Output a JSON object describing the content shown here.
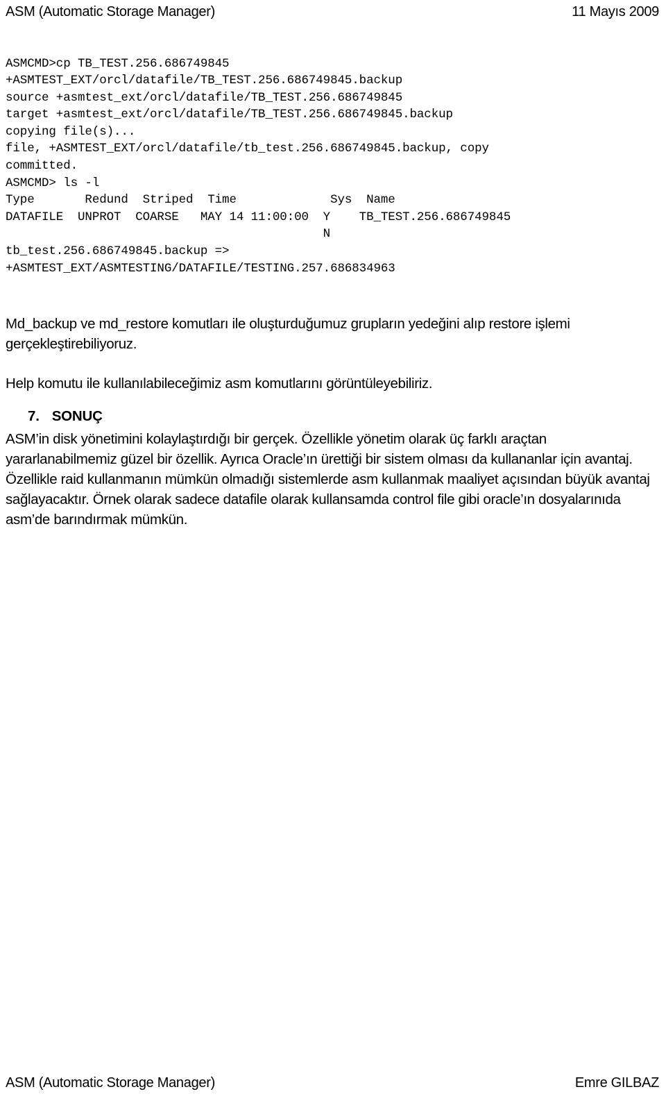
{
  "header": {
    "title": "ASM (Automatic Storage Manager)",
    "date": "11 Mayıs 2009"
  },
  "code_block": {
    "lines": [
      "ASMCMD>cp TB_TEST.256.686749845",
      "+ASMTEST_EXT/orcl/datafile/TB_TEST.256.686749845.backup",
      "source +asmtest_ext/orcl/datafile/TB_TEST.256.686749845",
      "target +asmtest_ext/orcl/datafile/TB_TEST.256.686749845.backup",
      "copying file(s)...",
      "file, +ASMTEST_EXT/orcl/datafile/tb_test.256.686749845.backup, copy",
      "committed.",
      "ASMCMD> ls -l",
      "Type       Redund  Striped  Time             Sys  Name",
      "DATAFILE  UNPROT  COARSE   MAY 14 11:00:00  Y    TB_TEST.256.686749845",
      "                                            N",
      "tb_test.256.686749845.backup =>",
      "+ASMTEST_EXT/ASMTESTING/DATAFILE/TESTING.257.686834963"
    ]
  },
  "body": {
    "paragraph_md": "Md_backup ve md_restore komutları ile oluşturduğumuz grupların yedeğini alıp restore işlemi gerçekleştirebiliyoruz.",
    "paragraph_help": "Help komutu ile kullanılabileceğimiz asm komutlarını görüntüleyebiliriz."
  },
  "section": {
    "number": "7.",
    "title": "SONUÇ",
    "conclusion": "ASM’in disk yönetimini kolaylaştırdığı bir gerçek. Özellikle yönetim olarak üç farklı araçtan yararlanabilmemiz güzel bir özellik. Ayrıca Oracle’ın ürettiği bir sistem olması da kullananlar için avantaj. Özellikle raid kullanmanın mümkün olmadığı sistemlerde asm kullanmak maaliyet açısından büyük avantaj sağlayacaktır.  Örnek olarak sadece datafile olarak kullansamda control file gibi oracle’ın dosyalarınıda asm’de barındırmak mümkün."
  },
  "footer": {
    "title": "ASM (Automatic Storage Manager)",
    "author": "Emre GILBAZ"
  }
}
